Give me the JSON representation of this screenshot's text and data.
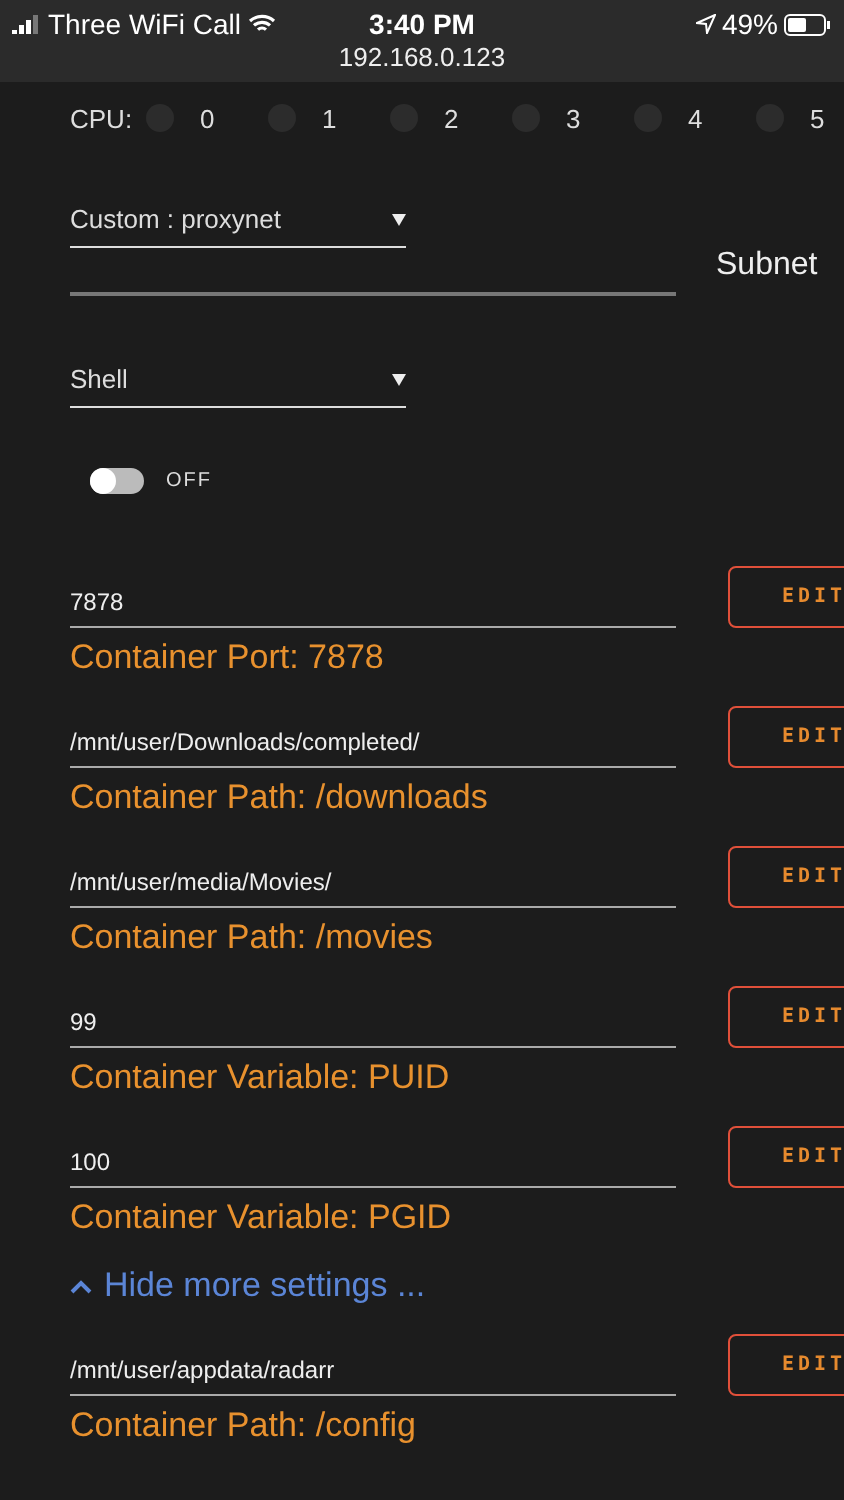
{
  "status_bar": {
    "carrier": "Three WiFi Call",
    "time": "3:40 PM",
    "battery": "49%",
    "url": "192.168.0.123"
  },
  "cpu": {
    "label": "CPU:",
    "cores": [
      {
        "label": "0",
        "checked": false
      },
      {
        "label": "1",
        "checked": false
      },
      {
        "label": "2",
        "checked": false
      },
      {
        "label": "3",
        "checked": false
      },
      {
        "label": "4",
        "checked": false
      },
      {
        "label": "5",
        "checked": false
      }
    ]
  },
  "network": {
    "value": "Custom : proxynet"
  },
  "subnet_label": "Subnet",
  "console": {
    "value": "Shell"
  },
  "privileged": {
    "on": false,
    "label": "OFF"
  },
  "settings": [
    {
      "value": "7878",
      "label": "Container Port: 7878",
      "button": "EDIT"
    },
    {
      "value": "/mnt/user/Downloads/completed/",
      "label": "Container Path: /downloads",
      "button": "EDIT"
    },
    {
      "value": "/mnt/user/media/Movies/",
      "label": "Container Path: /movies",
      "button": "EDIT"
    },
    {
      "value": "99",
      "label": "Container Variable: PUID",
      "button": "EDIT"
    },
    {
      "value": "100",
      "label": "Container Variable: PGID",
      "button": "EDIT"
    }
  ],
  "toggle_link": {
    "label": "Hide more settings ...",
    "expanded": true
  },
  "more_settings": [
    {
      "value": "/mnt/user/appdata/radarr",
      "label": "Container Path: /config",
      "button": "EDIT"
    }
  ]
}
